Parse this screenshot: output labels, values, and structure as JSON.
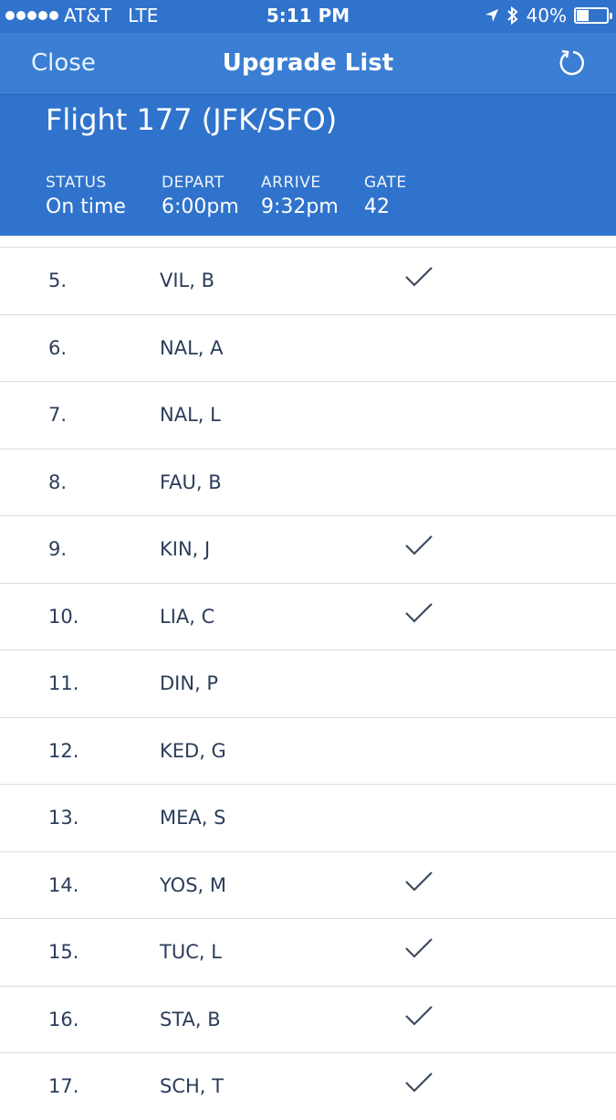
{
  "status_bar": {
    "carrier": "AT&T",
    "network": "LTE",
    "time": "5:11 PM",
    "battery": "40%",
    "battery_level": 0.4,
    "icons": [
      "signal-dots-icon",
      "location-arrow-icon",
      "bluetooth-icon",
      "battery-icon"
    ]
  },
  "nav": {
    "close_label": "Close",
    "title": "Upgrade List",
    "refresh_icon": "refresh-icon"
  },
  "flight": {
    "title": "Flight 177 (JFK/SFO)",
    "status_label": "STATUS",
    "status_value": "On time",
    "depart_label": "DEPART",
    "depart_value": "6:00pm",
    "arrive_label": "ARRIVE",
    "arrive_value": "9:32pm",
    "gate_label": "GATE",
    "gate_value": "42"
  },
  "colors": {
    "header": "#3073cc",
    "text_dark": "#2b3d5a",
    "divider": "#dcdcdc"
  },
  "passengers": [
    {
      "num": "5.",
      "name": "VIL, B",
      "checked": true
    },
    {
      "num": "6.",
      "name": "NAL, A",
      "checked": false
    },
    {
      "num": "7.",
      "name": "NAL, L",
      "checked": false
    },
    {
      "num": "8.",
      "name": "FAU, B",
      "checked": false
    },
    {
      "num": "9.",
      "name": "KIN, J",
      "checked": true
    },
    {
      "num": "10.",
      "name": "LIA, C",
      "checked": true
    },
    {
      "num": "11.",
      "name": "DIN, P",
      "checked": false
    },
    {
      "num": "12.",
      "name": "KED, G",
      "checked": false
    },
    {
      "num": "13.",
      "name": "MEA, S",
      "checked": false
    },
    {
      "num": "14.",
      "name": "YOS, M",
      "checked": true
    },
    {
      "num": "15.",
      "name": "TUC, L",
      "checked": true
    },
    {
      "num": "16.",
      "name": "STA, B",
      "checked": true
    },
    {
      "num": "17.",
      "name": "SCH, T",
      "checked": true
    }
  ]
}
